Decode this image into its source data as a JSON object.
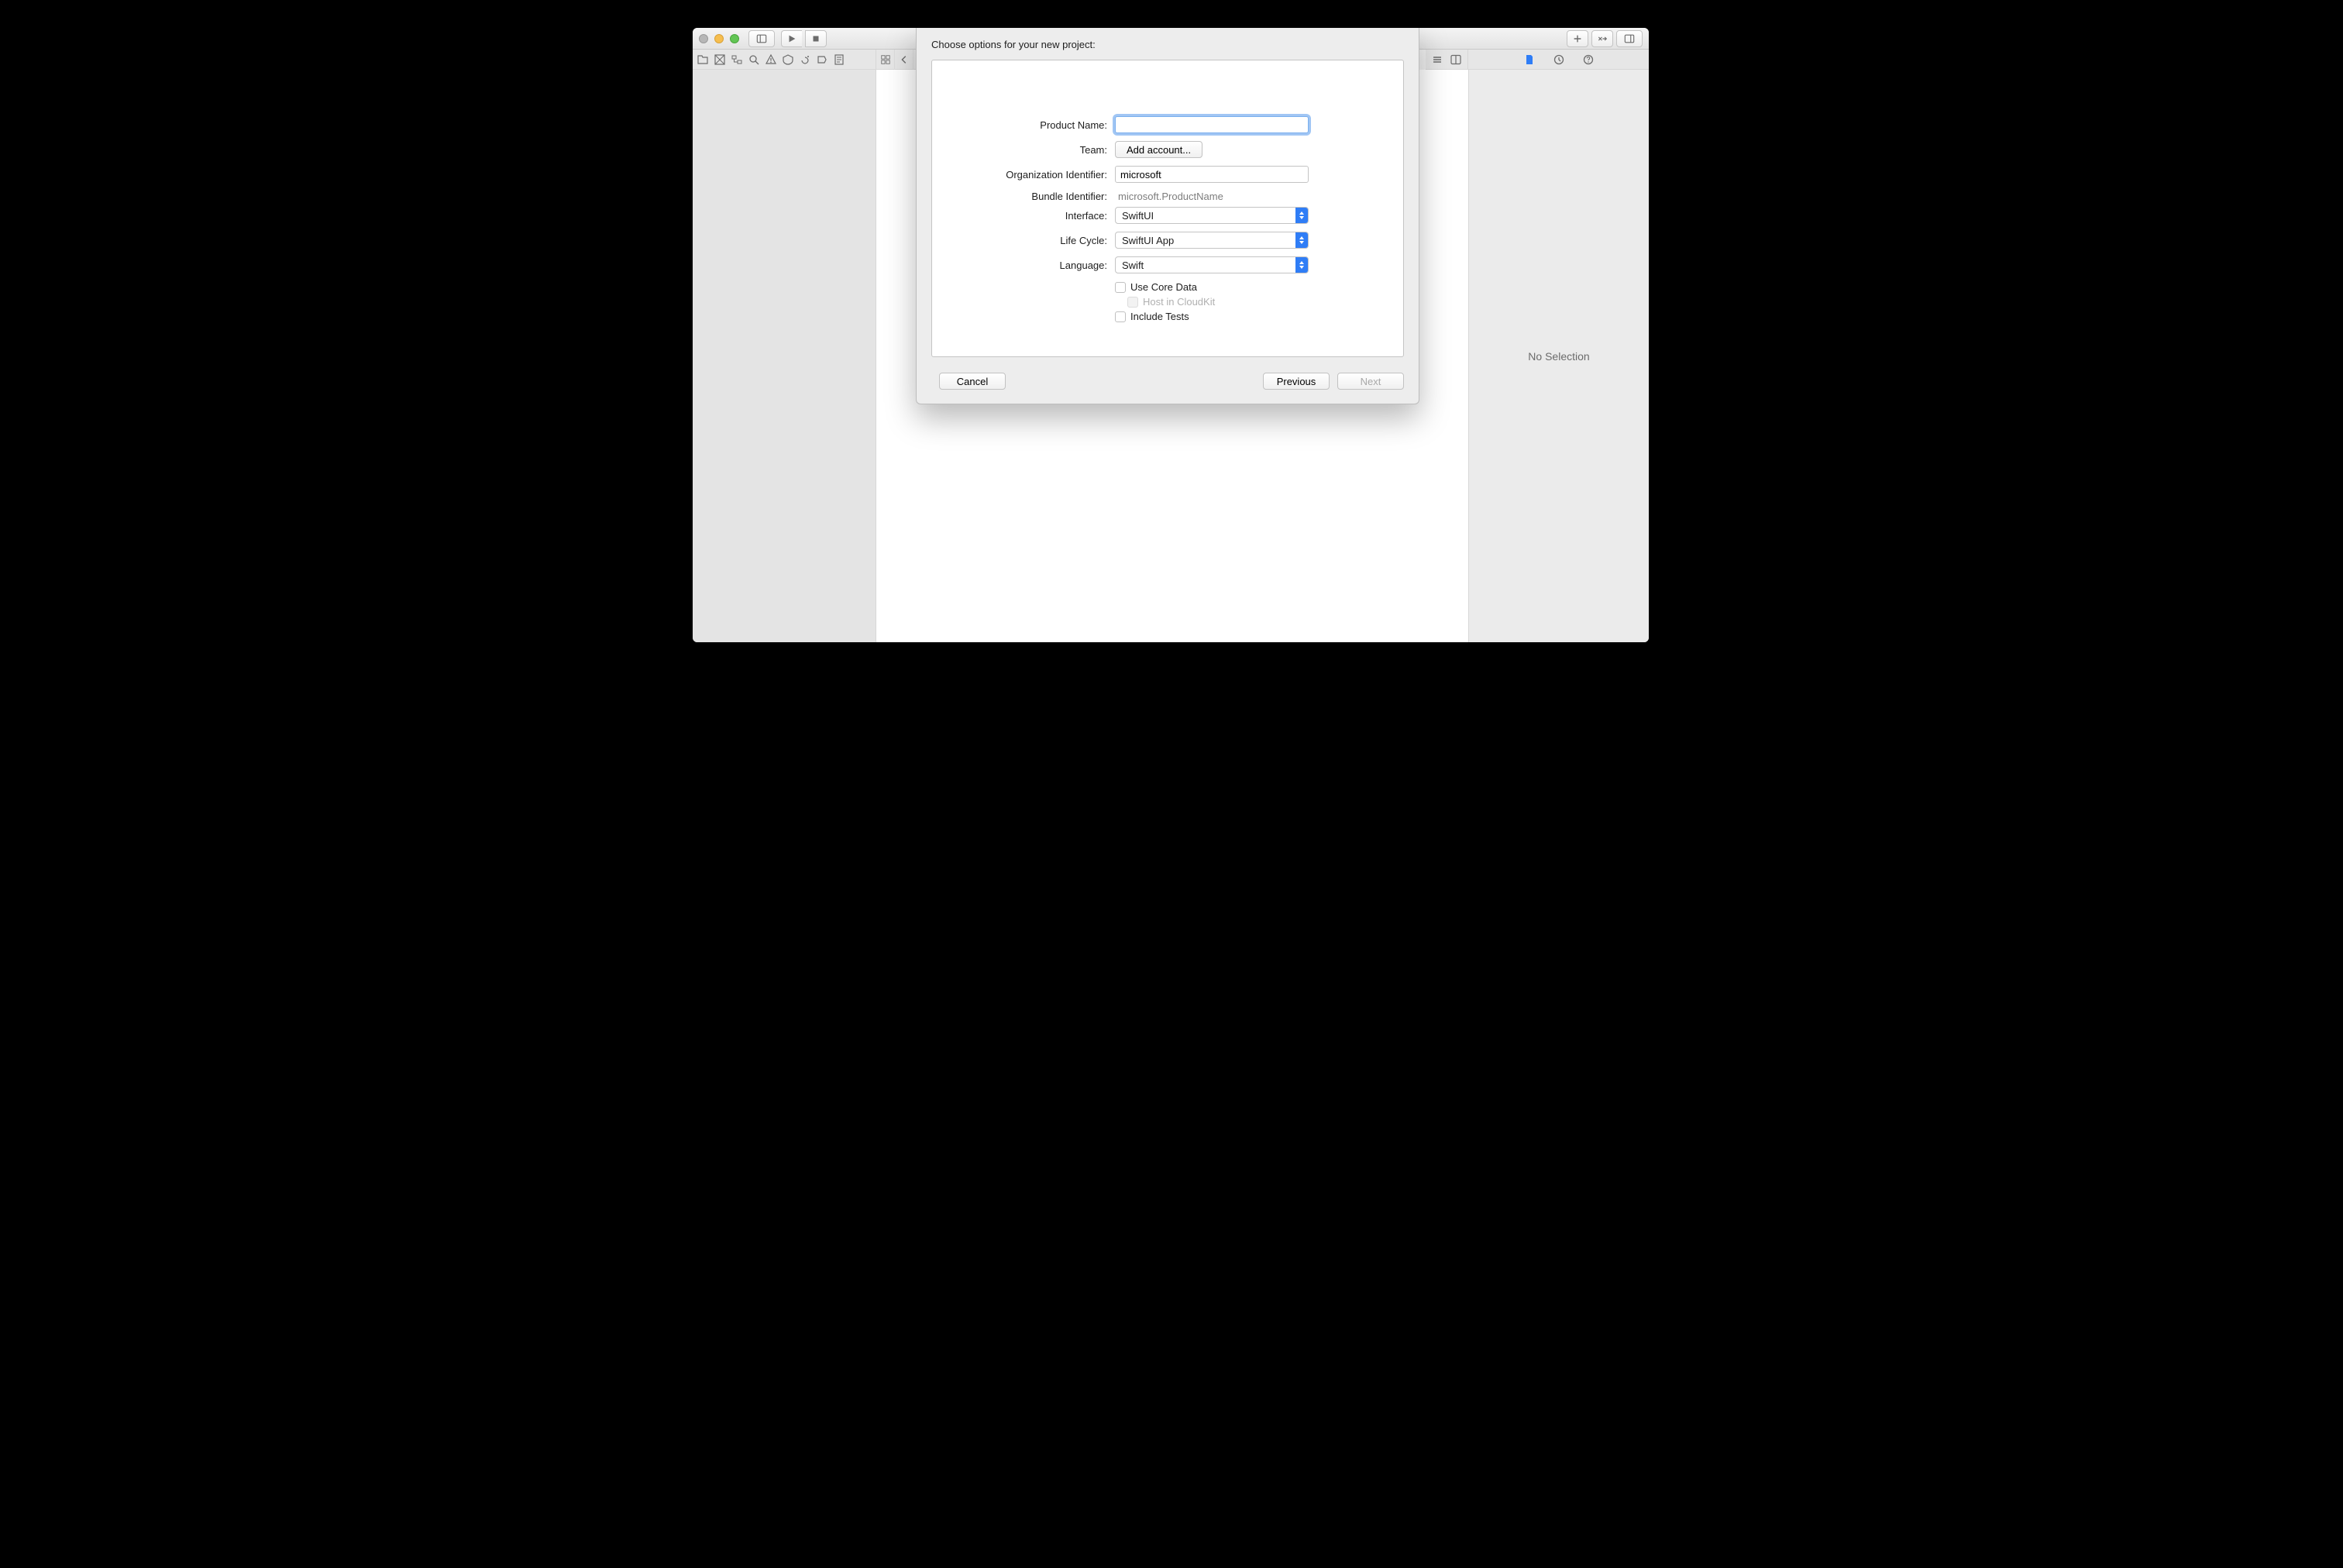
{
  "titlebar": {
    "search_placeholder": ""
  },
  "no_selection_tab": "No Selection",
  "inspector_empty": "No Selection",
  "sheet": {
    "heading": "Choose options for your new project:",
    "labels": {
      "product_name": "Product Name:",
      "team": "Team:",
      "org_identifier": "Organization Identifier:",
      "bundle_identifier": "Bundle Identifier:",
      "interface": "Interface:",
      "lifecycle": "Life Cycle:",
      "language": "Language:"
    },
    "values": {
      "product_name": "",
      "team_button": "Add account...",
      "org_identifier": "microsoft",
      "bundle_identifier": "microsoft.ProductName",
      "interface": "SwiftUI",
      "lifecycle": "SwiftUI App",
      "language": "Swift"
    },
    "checkboxes": {
      "core_data": "Use Core Data",
      "cloudkit": "Host in CloudKit",
      "include_tests": "Include Tests"
    },
    "buttons": {
      "cancel": "Cancel",
      "previous": "Previous",
      "next": "Next"
    }
  }
}
